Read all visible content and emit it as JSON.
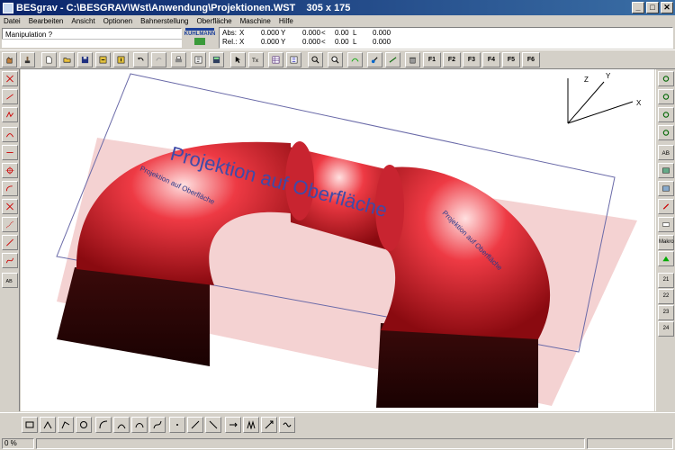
{
  "window": {
    "title": "BESgrav - C:\\BESGRAV\\Wst\\Anwendung\\Projektionen.WST    305 x 175",
    "minimize": "_",
    "maximize": "□",
    "close": "✕"
  },
  "menu": [
    "Datei",
    "Bearbeiten",
    "Ansicht",
    "Optionen",
    "Bahnerstellung",
    "Oberfläche",
    "Maschine",
    "Hilfe"
  ],
  "status": {
    "mode": "Manipulation ?"
  },
  "logo": {
    "text": "KUHLMANN"
  },
  "coords": {
    "abs": {
      "label": "Abs:",
      "x_label": "X",
      "x": "0.000",
      "y_label": "Y",
      "y": "0.000",
      "z_label": "<",
      "z": "0.00",
      "l_label": "L",
      "l": "0.000"
    },
    "rel": {
      "label": "Rel.:",
      "x_label": "X",
      "x": "0.000",
      "y_label": "Y",
      "y": "0.000",
      "z_label": "<",
      "z": "0.00",
      "l_label": "L",
      "l": "0.000"
    }
  },
  "toolbar": {
    "icons": [
      "hand-icon",
      "stamp-icon",
      "new-file-icon",
      "open-folder-icon",
      "save-icon",
      "import-icon",
      "export-icon",
      "undo-icon",
      "redo-icon",
      "print-icon",
      "text-icon",
      "calculator-icon",
      "select-icon",
      "text-align-icon",
      "spreadsheet-icon",
      "list-icon",
      "zoom-window-icon",
      "zoom-icon",
      "zoom-3d-icon",
      "paint-icon",
      "sweep-icon",
      "trash-icon"
    ],
    "function_keys": [
      "F1",
      "F2",
      "F3",
      "F4",
      "F5",
      "F6"
    ]
  },
  "left_tools": [
    "line-icon",
    "line-angle-icon",
    "polyline-icon",
    "curve-icon",
    "cross-icon",
    "crosshair-icon",
    "circle-icon",
    "arc-icon",
    "star-icon",
    "diagonal-icon",
    "spline-icon",
    "ab-icon"
  ],
  "right_tools": {
    "icons": [
      "gear-icon",
      "gear-icon",
      "gear-icon",
      "gear-icon",
      "text-box-icon",
      "image-icon",
      "image-icon",
      "arrow-red-icon",
      "keyboard-icon"
    ],
    "labels": [
      "Makro",
      "21",
      "22",
      "23",
      "24"
    ]
  },
  "canvas": {
    "text_main": "Projektion auf Oberfläche",
    "text_left": "Projektion auf Oberfläche",
    "text_right": "Projektion auf Oberfläche",
    "axis_x": "X",
    "axis_y": "Y",
    "axis_z": "Z"
  },
  "bottom_tools": [
    "rectangle-icon",
    "polyline-icon",
    "polygon-icon",
    "circle-icon",
    "arc-icon",
    "curve-icon",
    "ellipse-icon",
    "bezier-icon",
    "point-icon",
    "rotate-icon",
    "mirror-icon",
    "offset-icon",
    "trim-icon",
    "extend-icon",
    "wave-icon"
  ],
  "statusbar": {
    "zoom": "0 %"
  },
  "colors": {
    "titlebar": "#0a246a",
    "surface": "#e8232f",
    "plane": "#f2d4d4"
  }
}
